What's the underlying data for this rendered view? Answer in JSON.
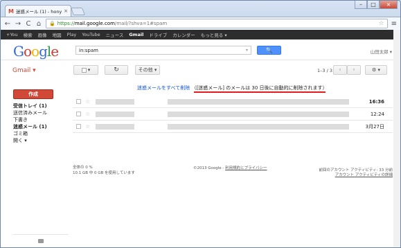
{
  "browser": {
    "tab_title": "迷惑メール (1) - honyanon",
    "tab_close": "×",
    "url_https": "https://",
    "url_host": "mail.google.com",
    "url_path": "/mail/?shva=1#spam",
    "nav_back": "←",
    "nav_forward": "→",
    "nav_reload": "C",
    "nav_home": "⌂",
    "star": "☆",
    "menu": "≡",
    "win_min": "–",
    "win_max": "□",
    "win_close": "×"
  },
  "gbar": {
    "items": [
      "+You",
      "検索",
      "画像",
      "地図",
      "Play",
      "YouTube",
      "ニュース",
      "Gmail",
      "ドライブ",
      "カレンダー",
      "もっと見る ▾"
    ],
    "active_index": 7
  },
  "header": {
    "logo": [
      "G",
      "o",
      "o",
      "g",
      "l",
      "e"
    ],
    "search_value": "in:spam",
    "search_dropdown": "▾",
    "search_button": "🔍",
    "user_name": "山田太郎 ▾"
  },
  "actions": {
    "gmail_label": "Gmail ▾",
    "select_caret": "▾",
    "refresh": "↻",
    "more_label": "その他 ▾",
    "pager": "1–3 / 3",
    "prev": "‹",
    "next": "›",
    "settings": "⚙ ▾"
  },
  "sidebar": {
    "compose": "作成",
    "items": [
      {
        "label": "受信トレイ (1)",
        "bold": true
      },
      {
        "label": "送信済みメール",
        "bold": false
      },
      {
        "label": "下書き",
        "bold": false
      },
      {
        "label": "迷惑メール (1)",
        "bold": true
      },
      {
        "label": "ゴミ箱",
        "bold": false
      },
      {
        "label": "開く ▾",
        "bold": false
      }
    ]
  },
  "main": {
    "notice_link": "迷惑メールをすべて削除",
    "notice_text": "（[迷惑メール] のメールは 30 日後に自動的に削除されます）",
    "rows": [
      {
        "date": "16:36",
        "bold": true
      },
      {
        "date": "12:24",
        "bold": false
      },
      {
        "date": "3月27日",
        "bold": false
      }
    ],
    "footer_usage_1": "全体の 0 %",
    "footer_usage_2": "10.1 GB 中 0 GB を使用しています",
    "footer_copyright": "©2013 Google - ",
    "footer_terms": "利用規約とプライバシー",
    "footer_activity": "前回のアカウント アクティビティ: 33 分前",
    "footer_details": "アカウント アクティビティの詳細"
  },
  "colors": {
    "compose_red": "#d14836",
    "notice_underline": "#e51a1a",
    "search_blue": "#4d90fe",
    "gbar_dark": "#2d2d2d"
  }
}
